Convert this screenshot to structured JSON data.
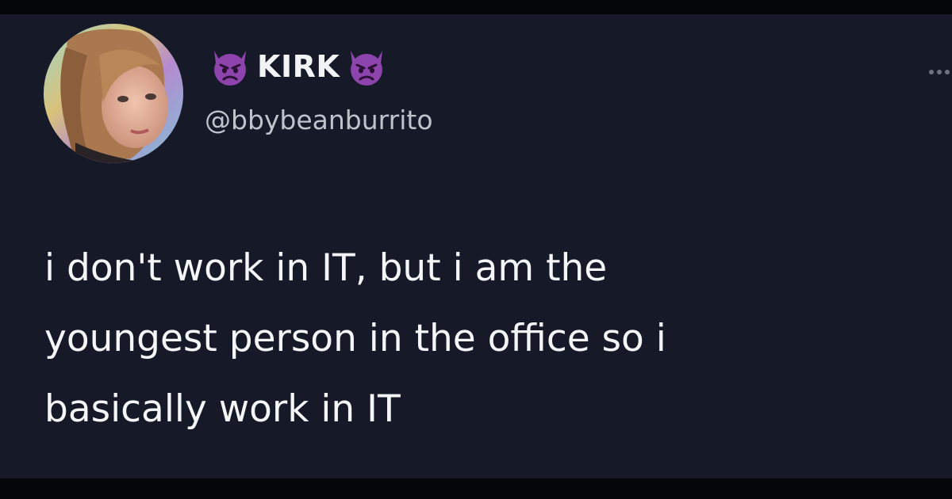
{
  "tweet": {
    "author": {
      "display_name": "KIRK",
      "handle": "@bbybeanburrito",
      "name_emoji_icon": "angry-devil-icon",
      "avatar_icon": "profile-photo"
    },
    "more_icon": "more-options-icon",
    "text": "i don't work in IT, but i am the\nyoungest person in the office so i\nbasically work in IT"
  },
  "colors": {
    "background": "#151928",
    "text": "#f4f5f7",
    "handle": "#bfc3cc",
    "emoji": "#8e44ad"
  }
}
